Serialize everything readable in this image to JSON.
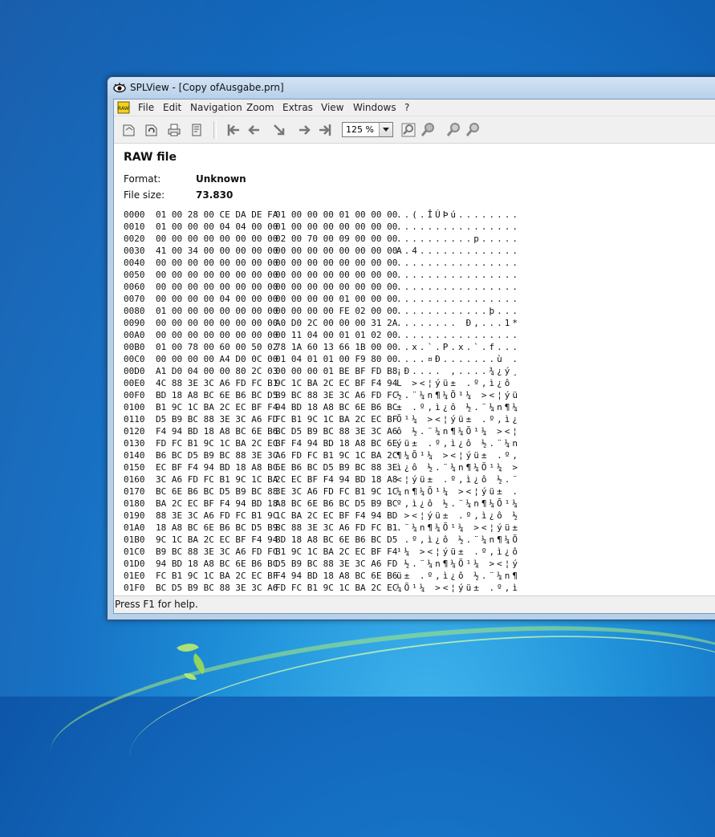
{
  "window": {
    "title": "SPLView - [Copy ofAusgabe.prn]"
  },
  "menu": {
    "items": [
      "File",
      "Edit",
      "Navigation",
      "Zoom",
      "Extras",
      "View",
      "Windows",
      "?"
    ]
  },
  "toolbar": {
    "zoom_value": "125 %",
    "icons": [
      "open-icon",
      "reload-icon",
      "print-icon",
      "properties-icon",
      "first-page-icon",
      "previous-page-icon",
      "goto-page-icon",
      "next-page-icon",
      "last-page-icon",
      "zoom-window-icon",
      "zoom-fit-icon",
      "zoom-in-icon",
      "zoom-out-icon"
    ]
  },
  "file": {
    "heading": "RAW file",
    "format_label": "Format:",
    "format_value": "Unknown",
    "size_label": "File size:",
    "size_value": "73.830"
  },
  "hex_rows": [
    [
      "0000",
      "01 00 28 00 CE DA DE FA",
      "01 00 00 00 01 00 00 00",
      "..(.ÎÚÞú........"
    ],
    [
      "0010",
      "01 00 00 00 04 04 00 00",
      "01 00 00 00 00 00 00 00",
      "................"
    ],
    [
      "0020",
      "00 00 00 00 00 00 00 00",
      "02 00 70 00 09 00 00 00",
      "..........p....."
    ],
    [
      "0030",
      "41 00 34 00 00 00 00 00",
      "00 00 00 00 00 00 00 00",
      "A.4............."
    ],
    [
      "0040",
      "00 00 00 00 00 00 00 00",
      "00 00 00 00 00 00 00 00",
      "................"
    ],
    [
      "0050",
      "00 00 00 00 00 00 00 00",
      "00 00 00 00 00 00 00 00",
      "................"
    ],
    [
      "0060",
      "00 00 00 00 00 00 00 00",
      "00 00 00 00 00 00 00 00",
      "................"
    ],
    [
      "0070",
      "00 00 00 00 04 00 00 00",
      "00 00 00 00 01 00 00 00",
      "................"
    ],
    [
      "0080",
      "01 00 00 00 00 00 00 00",
      "00 00 00 00 FE 02 00 00",
      "............þ..."
    ],
    [
      "0090",
      "00 00 00 00 00 00 00 00",
      "A0 D0 2C 00 00 00 31 2A",
      "........ Ð,...1*"
    ],
    [
      "00A0",
      "00 00 00 00 00 00 00 00",
      "00 11 04 00 01 01 02 00",
      "................"
    ],
    [
      "00B0",
      "01 00 78 00 60 00 50 02",
      "78 1A 60 13 66 1B 00 00",
      "..x.`.P.x.`.f..."
    ],
    [
      "00C0",
      "00 00 00 00 A4 D0 0C 00",
      "01 04 01 01 00 F9 80 00",
      "....¤Ð.......ù ."
    ],
    [
      "00D0",
      "A1 D0 04 00 00 80 2C 03",
      "00 00 00 01 BE BF FD B8",
      "¡Ð.... ,....¾¿ý¸"
    ],
    [
      "00E0",
      "4C 88 3E 3C A6 FD FC B1",
      "9C 1C BA 2C EC BF F4 94",
      "L ><¦ýü± .º,ì¿ô "
    ],
    [
      "00F0",
      "BD 18 A8 BC 6E B6 BC D5",
      "B9 BC 88 3E 3C A6 FD FC",
      "½.¨¼n¶¼Õ¹¼ ><¦ýü"
    ],
    [
      "0100",
      "B1 9C 1C BA 2C EC BF F4",
      "94 BD 18 A8 BC 6E B6 BC",
      "± .º,ì¿ô ½.¨¼n¶¼"
    ],
    [
      "0110",
      "D5 B9 BC 88 3E 3C A6 FD",
      "FC B1 9C 1C BA 2C EC BF",
      "Õ¹¼ ><¦ýü± .º,ì¿"
    ],
    [
      "0120",
      "F4 94 BD 18 A8 BC 6E B6",
      "BC D5 B9 BC 88 3E 3C A6",
      "ô ½.¨¼n¶¼Õ¹¼ ><¦"
    ],
    [
      "0130",
      "FD FC B1 9C 1C BA 2C EC",
      "BF F4 94 BD 18 A8 BC 6E",
      "ýü± .º,ì¿ô ½.¨¼n"
    ],
    [
      "0140",
      "B6 BC D5 B9 BC 88 3E 3C",
      "A6 FD FC B1 9C 1C BA 2C",
      "¶¼Õ¹¼ ><¦ýü± .º,"
    ],
    [
      "0150",
      "EC BF F4 94 BD 18 A8 BC",
      "6E B6 BC D5 B9 BC 88 3E",
      "ì¿ô ½.¨¼n¶¼Õ¹¼ >"
    ],
    [
      "0160",
      "3C A6 FD FC B1 9C 1C BA",
      "2C EC BF F4 94 BD 18 A8",
      "<¦ýü± .º,ì¿ô ½.¨"
    ],
    [
      "0170",
      "BC 6E B6 BC D5 B9 BC 88",
      "3E 3C A6 FD FC B1 9C 1C",
      "¼n¶¼Õ¹¼ ><¦ýü± ."
    ],
    [
      "0180",
      "BA 2C EC BF F4 94 BD 18",
      "A8 BC 6E B6 BC D5 B9 BC",
      "º,ì¿ô ½.¨¼n¶¼Õ¹¼"
    ],
    [
      "0190",
      "88 3E 3C A6 FD FC B1 9C",
      "1C BA 2C EC BF F4 94 BD",
      " ><¦ýü± .º,ì¿ô ½"
    ],
    [
      "01A0",
      "18 A8 BC 6E B6 BC D5 B9",
      "BC 88 3E 3C A6 FD FC B1",
      ".¨¼n¶¼Õ¹¼ ><¦ýü±"
    ],
    [
      "01B0",
      "9C 1C BA 2C EC BF F4 94",
      "BD 18 A8 BC 6E B6 BC D5",
      " .º,ì¿ô ½.¨¼n¶¼Õ"
    ],
    [
      "01C0",
      "B9 BC 88 3E 3C A6 FD FC",
      "B1 9C 1C BA 2C EC BF F4",
      "¹¼ ><¦ýü± .º,ì¿ô"
    ],
    [
      "01D0",
      "94 BD 18 A8 BC 6E B6 BC",
      "D5 B9 BC 88 3E 3C A6 FD",
      " ½.¨¼n¶¼Õ¹¼ ><¦ý"
    ],
    [
      "01E0",
      "FC B1 9C 1C BA 2C EC BF",
      "F4 94 BD 18 A8 BC 6E B6",
      "ü± .º,ì¿ô ½.¨¼n¶"
    ],
    [
      "01F0",
      "BC D5 B9 BC 88 3E 3C A6",
      "FD FC B1 9C 1C BA 2C EC",
      "¼Õ¹¼ ><¦ýü± .º,ì"
    ]
  ],
  "status": {
    "text": "Press F1 for help."
  }
}
